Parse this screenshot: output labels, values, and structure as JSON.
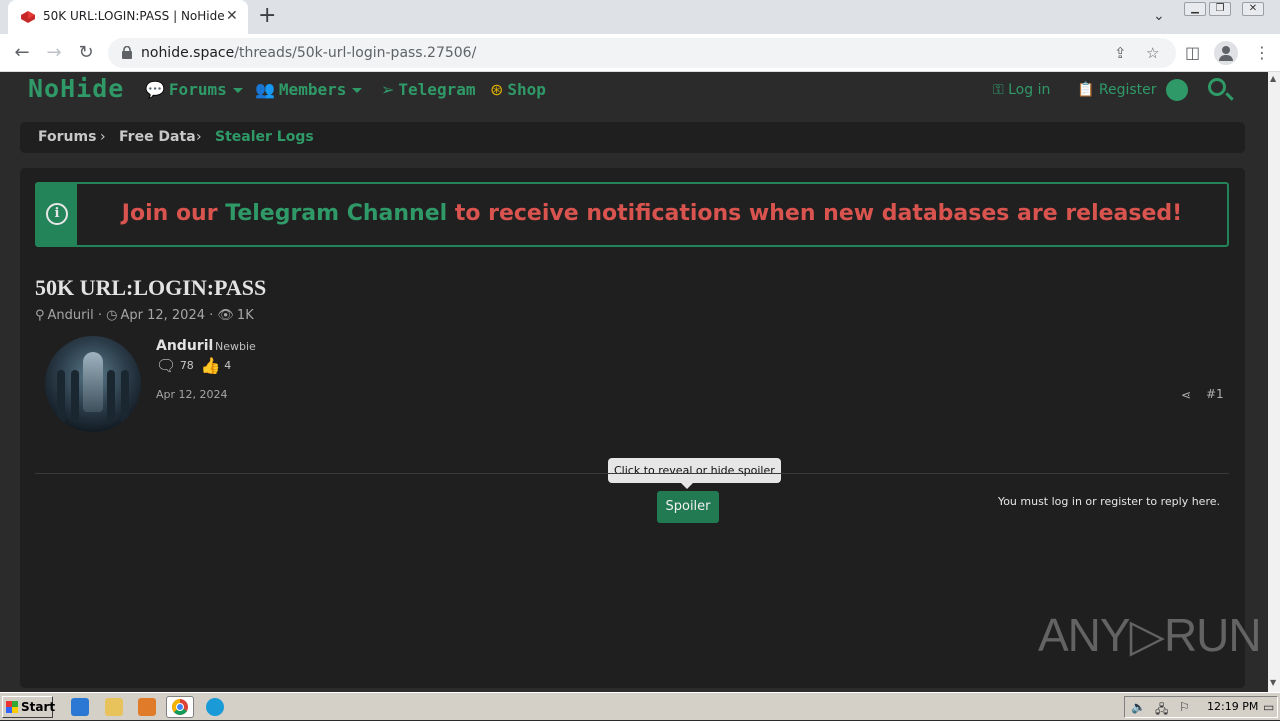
{
  "browser": {
    "tab_title": "50K URL:LOGIN:PASS | NoHide",
    "url_host": "nohide.space",
    "url_path": "/threads/50k-url-login-pass.27506/"
  },
  "site": {
    "logo": "NoHide",
    "nav": {
      "forums": "Forums",
      "members": "Members",
      "telegram": "Telegram",
      "shop": "Shop",
      "login": "Log in",
      "register": "Register"
    },
    "breadcrumb": [
      "Forums",
      "Free Data",
      "Stealer Logs"
    ]
  },
  "notice": {
    "before": "Join our ",
    "link": "Telegram Channel",
    "after": " to receive notifications when new databases are released!"
  },
  "thread": {
    "title": "50K URL:LOGIN:PASS",
    "author": "Anduril",
    "date": "Apr 12, 2024",
    "views": "1K"
  },
  "post": {
    "username": "Anduril",
    "role": "· Newbie",
    "messages": "78",
    "reactions": "4",
    "date": "Apr 12, 2024",
    "number": "#1",
    "spoiler_tooltip": "Click to reveal or hide spoiler",
    "spoiler_label": "Spoiler"
  },
  "reply_note": "You must log in or register to reply here.",
  "watermark": "ANY▷RUN",
  "taskbar": {
    "start": "Start",
    "clock": "12:19 PM"
  },
  "colors": {
    "accent_green": "#2f9a68",
    "notice_red": "#d9534f",
    "background": "#2b2b2b",
    "panel": "#1f1f1f"
  }
}
